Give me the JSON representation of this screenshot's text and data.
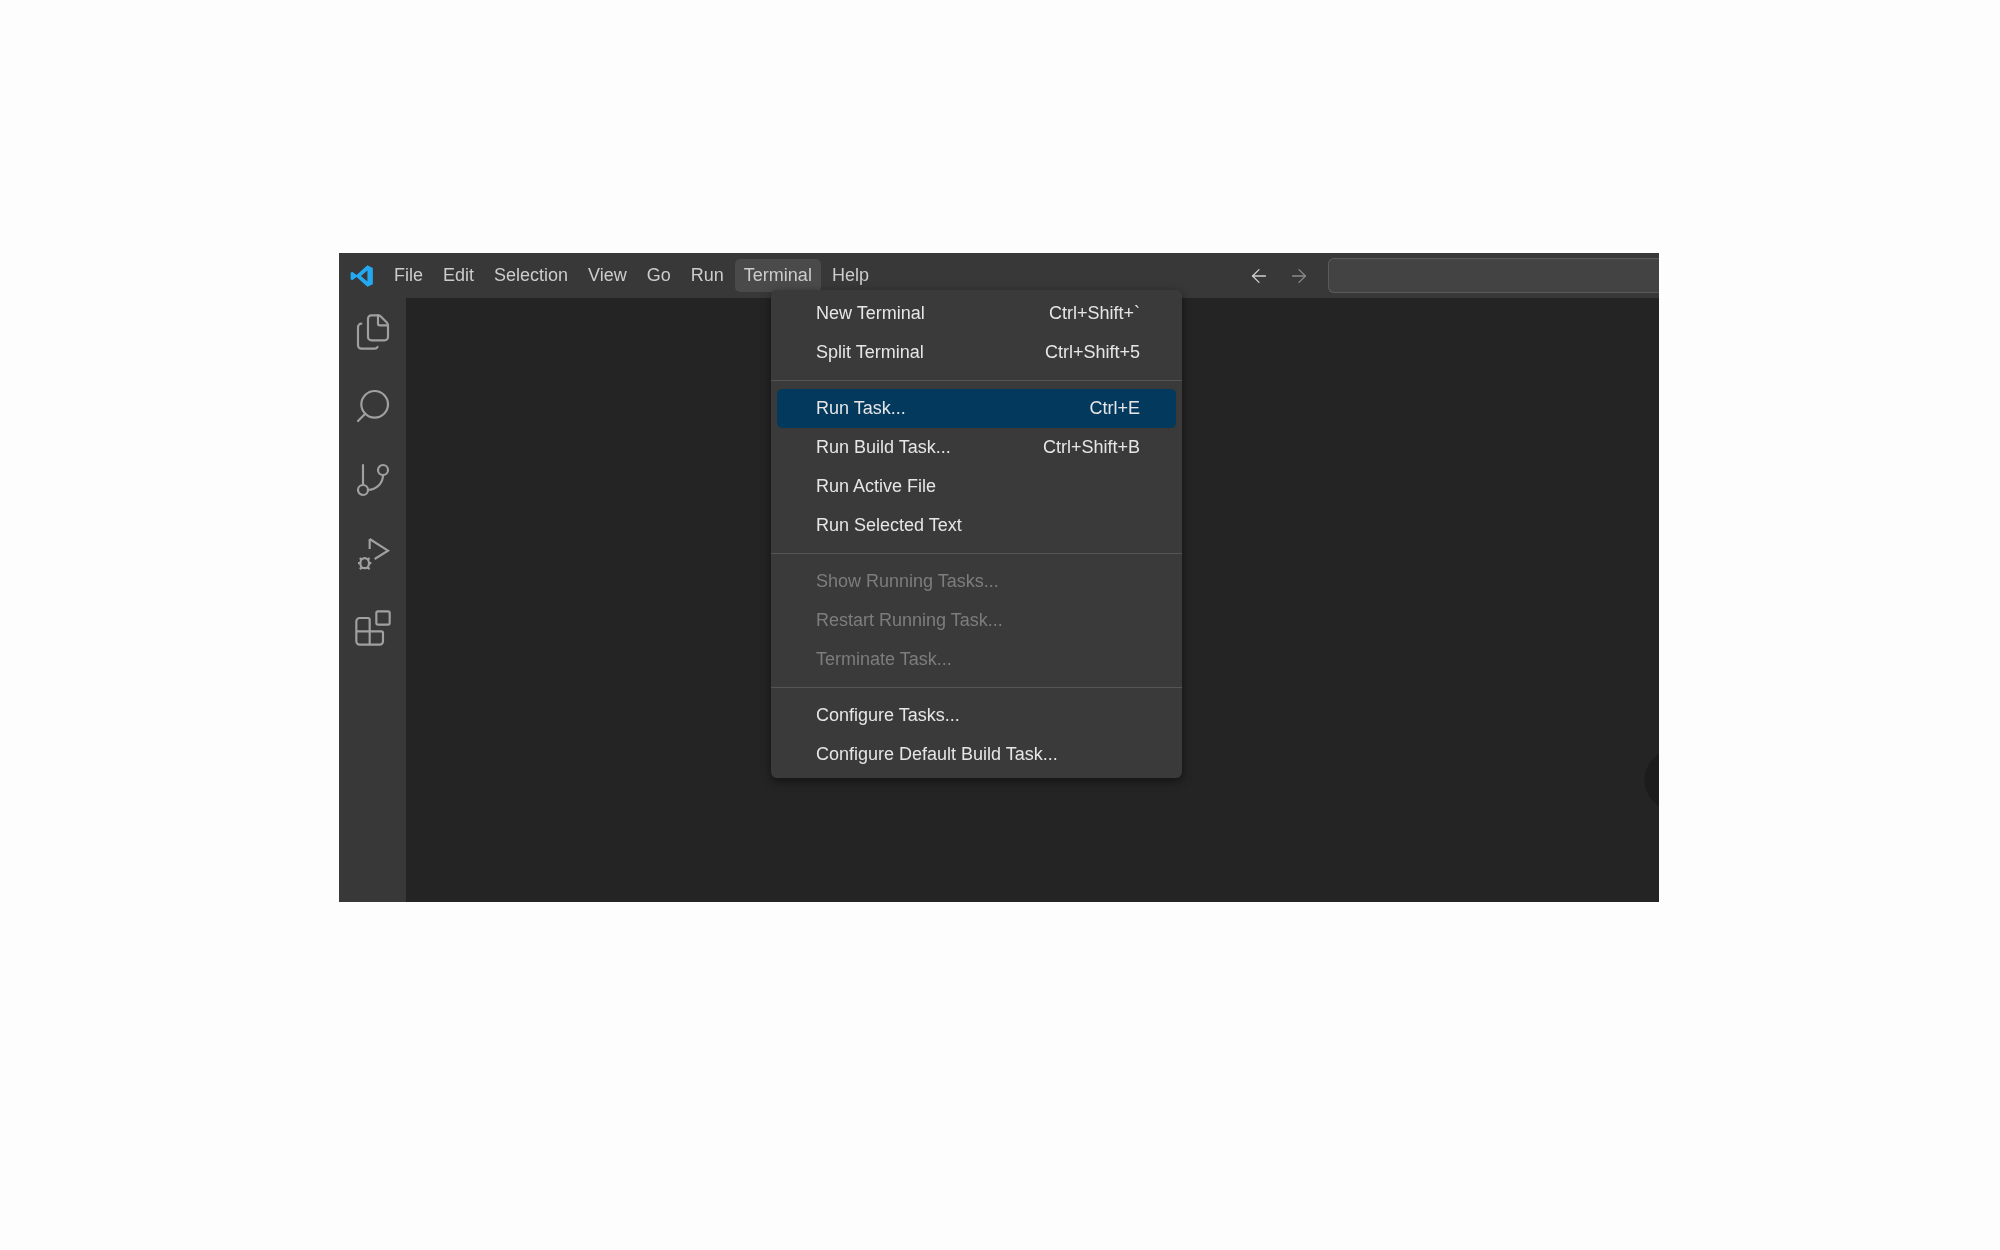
{
  "menubar": [
    {
      "label": "File",
      "selected": false
    },
    {
      "label": "Edit",
      "selected": false
    },
    {
      "label": "Selection",
      "selected": false
    },
    {
      "label": "View",
      "selected": false
    },
    {
      "label": "Go",
      "selected": false
    },
    {
      "label": "Run",
      "selected": false
    },
    {
      "label": "Terminal",
      "selected": true
    },
    {
      "label": "Help",
      "selected": false
    }
  ],
  "terminal_menu": {
    "groups": [
      {
        "items": [
          {
            "label": "New Terminal",
            "shortcut": "Ctrl+Shift+`",
            "selected": false,
            "disabled": false
          },
          {
            "label": "Split Terminal",
            "shortcut": "Ctrl+Shift+5",
            "selected": false,
            "disabled": false
          }
        ]
      },
      {
        "items": [
          {
            "label": "Run Task...",
            "shortcut": "Ctrl+E",
            "selected": true,
            "disabled": false
          },
          {
            "label": "Run Build Task...",
            "shortcut": "Ctrl+Shift+B",
            "selected": false,
            "disabled": false
          },
          {
            "label": "Run Active File",
            "selected": false,
            "disabled": false
          },
          {
            "label": "Run Selected Text",
            "selected": false,
            "disabled": false
          }
        ]
      },
      {
        "items": [
          {
            "label": "Show Running Tasks...",
            "selected": false,
            "disabled": true
          },
          {
            "label": "Restart Running Task...",
            "selected": false,
            "disabled": true
          },
          {
            "label": "Terminate Task...",
            "selected": false,
            "disabled": true
          }
        ]
      },
      {
        "items": [
          {
            "label": "Configure Tasks...",
            "selected": false,
            "disabled": false
          },
          {
            "label": "Configure Default Build Task...",
            "selected": false,
            "disabled": false
          }
        ]
      }
    ]
  }
}
